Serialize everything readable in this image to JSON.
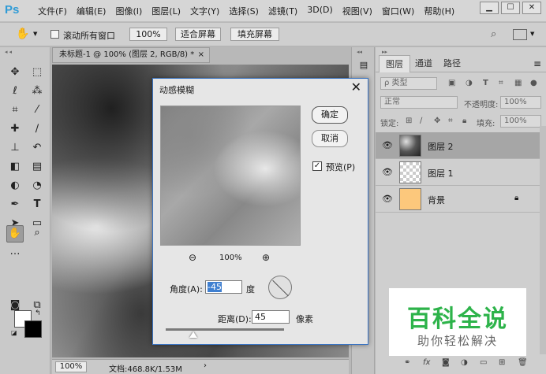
{
  "app": {
    "logo": "Ps"
  },
  "menu": [
    "文件(F)",
    "编辑(E)",
    "图像(I)",
    "图层(L)",
    "文字(Y)",
    "选择(S)",
    "滤镜(T)",
    "3D(D)",
    "视图(V)",
    "窗口(W)",
    "帮助(H)"
  ],
  "window_controls": {
    "minimize": "▁",
    "maximize": "☐",
    "close": "✕"
  },
  "options": {
    "scroll_all_label": "滚动所有窗口",
    "zoom_value": "100%",
    "fit_screen": "适合屏幕",
    "fill_screen": "填充屏幕"
  },
  "document": {
    "tab_title": "未标题-1 @ 100% (图层 2, RGB/8) *",
    "tab_close": "×",
    "status_zoom": "100%",
    "status_info": "文档:468.8K/1.53M",
    "status_arrow": "›"
  },
  "layers_panel": {
    "tabs": [
      "图层",
      "通道",
      "路径"
    ],
    "filter_label": "ρ 类型",
    "blend_mode": "正常",
    "opacity_label": "不透明度:",
    "opacity_value": "100%",
    "lock_label": "锁定:",
    "fill_label": "填充:",
    "fill_value": "100%",
    "layers": [
      {
        "name": "图层 2",
        "thumb": "clouds",
        "selected": true,
        "locked": false
      },
      {
        "name": "图层 1",
        "thumb": "transparent",
        "selected": false,
        "locked": false
      },
      {
        "name": "背景",
        "thumb": "fill",
        "selected": false,
        "locked": true
      }
    ],
    "footer_icons": [
      "link-icon",
      "fx-icon",
      "mask-icon",
      "adjustment-icon",
      "group-icon",
      "new-layer-icon",
      "trash-icon"
    ]
  },
  "dialog": {
    "title": "动感模糊",
    "ok": "确定",
    "cancel": "取消",
    "preview_label": "预览(P)",
    "preview_checked": true,
    "zoom_value": "100%",
    "angle_label": "角度(A):",
    "angle_value": "-45",
    "angle_unit": "度",
    "distance_label": "距离(D):",
    "distance_value": "45",
    "distance_unit": "像素"
  },
  "watermark": {
    "title": "百科全说",
    "subtitle": "助你轻松解决"
  },
  "colors": {
    "foreground": "#ffffff",
    "background": "#000000",
    "background_layer_fill": "#fcc87c",
    "ps_blue": "#2f9bd6",
    "watermark_green": "#2db34a"
  }
}
